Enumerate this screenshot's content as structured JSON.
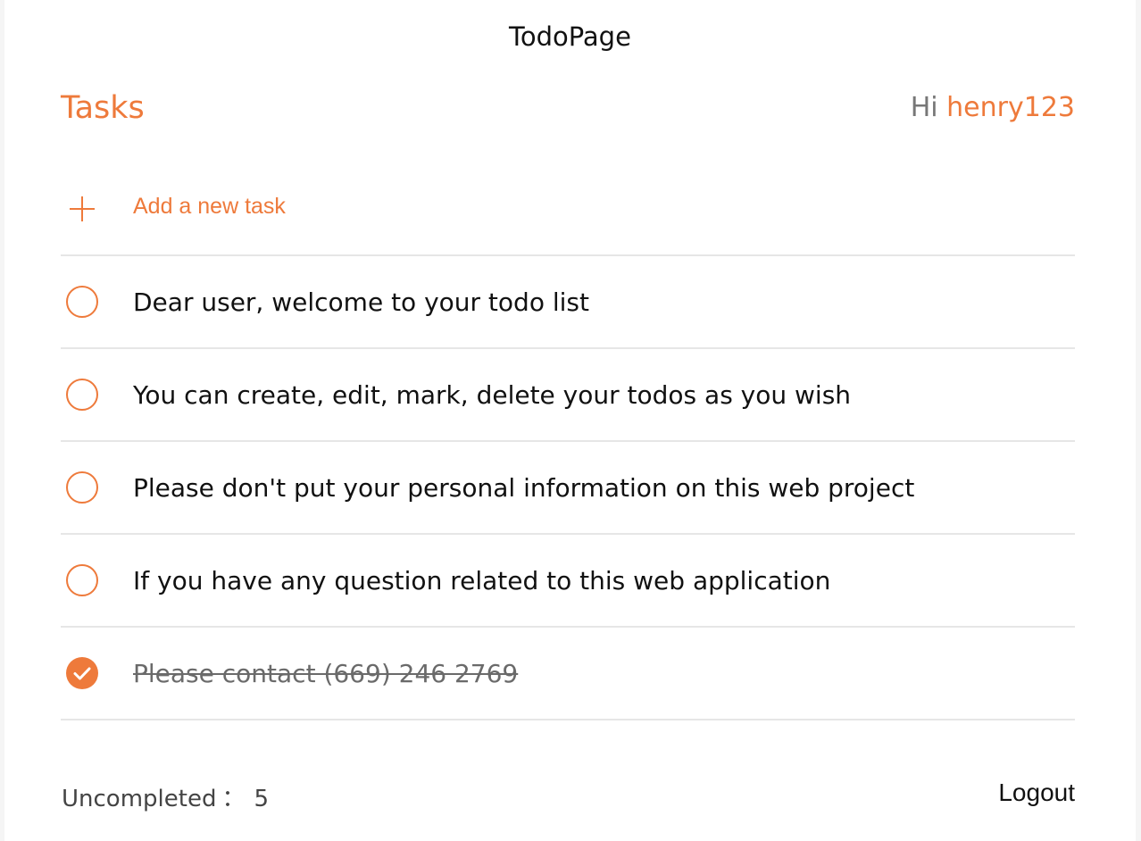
{
  "app": {
    "title": "TodoPage"
  },
  "header": {
    "heading": "Tasks",
    "greeting_prefix": "Hi",
    "username": "henry123"
  },
  "add_task": {
    "label": "Add a new task",
    "icon": "plus-icon"
  },
  "tasks": [
    {
      "text": "Dear user, welcome to your todo list",
      "completed": false
    },
    {
      "text": "You can create, edit, mark, delete your todos as you wish",
      "completed": false
    },
    {
      "text": "Please don't put your personal information on this web project",
      "completed": false
    },
    {
      "text": "If you have any question related to this web application",
      "completed": false
    },
    {
      "text": "Please contact (669) 246 2769",
      "completed": true
    }
  ],
  "footer": {
    "uncompleted_label": "Uncompleted",
    "uncompleted_sep": "：",
    "uncompleted_count": "5",
    "logout_label": "Logout"
  },
  "colors": {
    "accent": "#ee7a3b",
    "text": "#111111",
    "muted": "#777777",
    "divider": "#e6e6e6"
  }
}
